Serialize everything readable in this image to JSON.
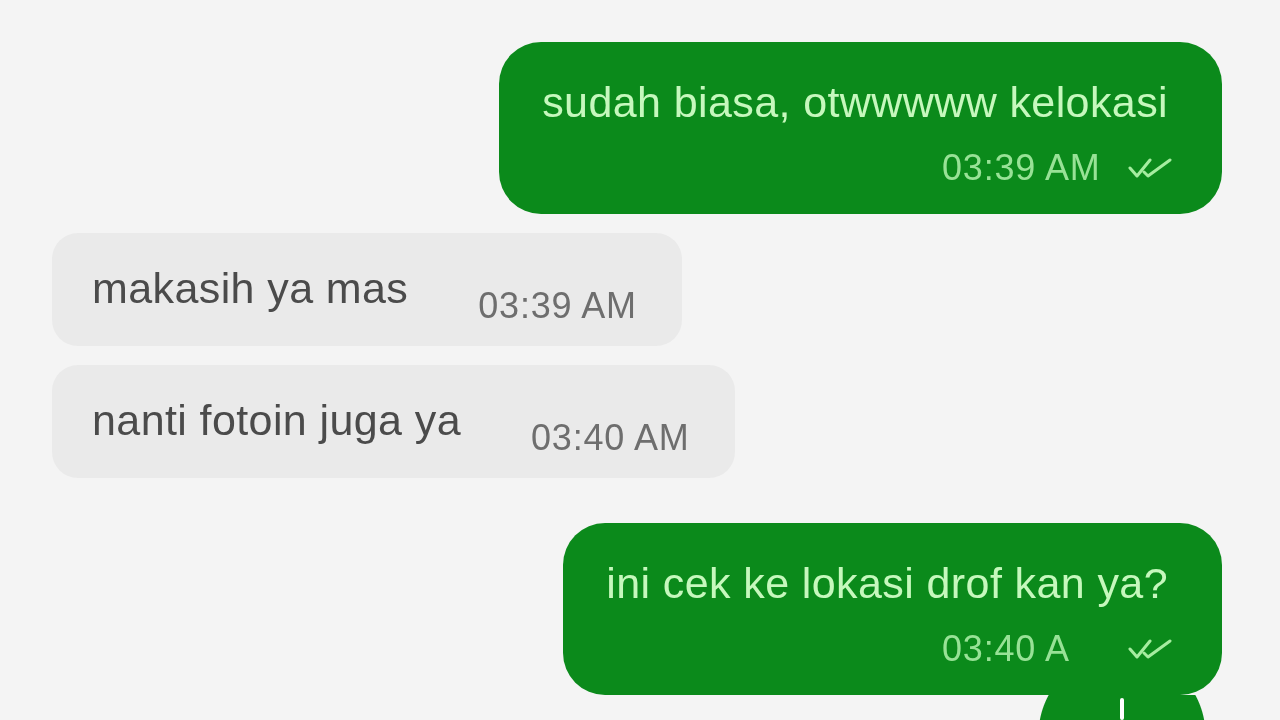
{
  "messages": [
    {
      "kind": "outgoing",
      "text": "sudah biasa, otwwwww kelokasi",
      "time": "03:39 AM",
      "delivered": true
    },
    {
      "kind": "incoming",
      "text": "makasih ya mas",
      "time": "03:39 AM"
    },
    {
      "kind": "incoming",
      "text": "nanti fotoin juga ya",
      "time": "03:40 AM"
    },
    {
      "kind": "outgoing",
      "text": "ini cek ke lokasi drof kan ya?",
      "time": "03:40 A",
      "delivered": true
    }
  ]
}
